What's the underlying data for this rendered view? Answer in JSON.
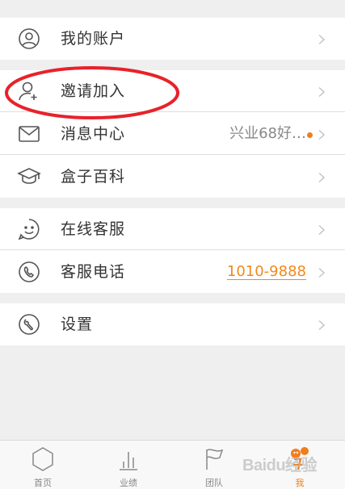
{
  "menu": {
    "account": {
      "label": "我的账户",
      "icon": "user-circle-icon"
    },
    "invite": {
      "label": "邀请加入",
      "icon": "add-user-icon"
    },
    "messages": {
      "label": "消息中心",
      "value": "兴业68好…",
      "icon": "mail-icon",
      "unread_dot_color": "#f07e1d"
    },
    "encyclopedia": {
      "label": "盒子百科",
      "icon": "graduation-cap-icon"
    },
    "online_service": {
      "label": "在线客服",
      "icon": "smile-icon"
    },
    "service_phone": {
      "label": "客服电话",
      "value": "1010-9888",
      "icon": "phone-icon"
    },
    "settings": {
      "label": "设置",
      "icon": "settings-icon"
    }
  },
  "annotation": {
    "color": "#e8222a",
    "shape": "ellipse"
  },
  "tabbar": {
    "tabs": [
      {
        "label": "首页",
        "icon": "hexagon-icon",
        "active": false
      },
      {
        "label": "业绩",
        "icon": "bar-chart-icon",
        "active": false
      },
      {
        "label": "团队",
        "icon": "flag-icon",
        "active": false
      },
      {
        "label": "我",
        "icon": "mascot-icon",
        "active": true
      }
    ],
    "active_color": "#f07e1d"
  },
  "watermark": {
    "text": "Baidu经验"
  }
}
